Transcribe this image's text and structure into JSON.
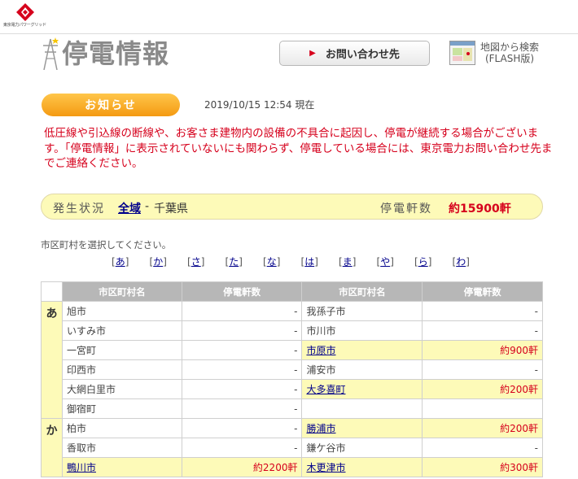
{
  "header": {
    "logo_text": "東京電力パワーグリッド",
    "title": "停電情報",
    "contact_button": "お問い合わせ先",
    "map_link_line1": "地図から検索",
    "map_link_line2": "(FLASH版)"
  },
  "news": {
    "badge": "お知らせ",
    "timestamp": "2019/10/15 12:54 現在",
    "notice": "低圧線や引込線の断線や、お客さま建物内の設備の不具合に起因し、停電が継続する場合がございます。「停電情報」に表示されていないにも関わらず、停電している場合には、東京電力お問い合わせ先までご連絡ください。"
  },
  "status": {
    "label": "発生状況",
    "region": "全域",
    "dash": "-",
    "prefecture": "千葉県",
    "count_label": "停電軒数",
    "count_value": "約15900軒"
  },
  "selector": {
    "prompt": "市区町村を選択してください。",
    "kana": [
      "あ",
      "か",
      "さ",
      "た",
      "な",
      "は",
      "ま",
      "や",
      "ら",
      "わ"
    ]
  },
  "table": {
    "headers": [
      "市区町村名",
      "停電軒数",
      "市区町村名",
      "停電軒数"
    ],
    "groups": [
      {
        "kana": "あ",
        "rows": [
          {
            "left": {
              "name": "旭市",
              "count": "-",
              "link": false
            },
            "right": {
              "name": "我孫子市",
              "count": "-",
              "link": false
            }
          },
          {
            "left": {
              "name": "いすみ市",
              "count": "-",
              "link": false
            },
            "right": {
              "name": "市川市",
              "count": "-",
              "link": false
            }
          },
          {
            "left": {
              "name": "一宮町",
              "count": "-",
              "link": false
            },
            "right": {
              "name": "市原市",
              "count": "約900軒",
              "link": true
            }
          },
          {
            "left": {
              "name": "印西市",
              "count": "-",
              "link": false
            },
            "right": {
              "name": "浦安市",
              "count": "-",
              "link": false
            }
          },
          {
            "left": {
              "name": "大網白里市",
              "count": "-",
              "link": false
            },
            "right": {
              "name": "大多喜町",
              "count": "約200軒",
              "link": true
            }
          },
          {
            "left": {
              "name": "御宿町",
              "count": "-",
              "link": false
            },
            "right": {
              "name": "",
              "count": "",
              "link": false
            }
          }
        ]
      },
      {
        "kana": "か",
        "rows": [
          {
            "left": {
              "name": "柏市",
              "count": "-",
              "link": false
            },
            "right": {
              "name": "勝浦市",
              "count": "約200軒",
              "link": true
            }
          },
          {
            "left": {
              "name": "香取市",
              "count": "-",
              "link": false
            },
            "right": {
              "name": "鎌ケ谷市",
              "count": "-",
              "link": false
            }
          },
          {
            "left": {
              "name": "鴨川市",
              "count": "約2200軒",
              "link": true
            },
            "right": {
              "name": "木更津市",
              "count": "約300軒",
              "link": true
            }
          }
        ]
      }
    ]
  }
}
